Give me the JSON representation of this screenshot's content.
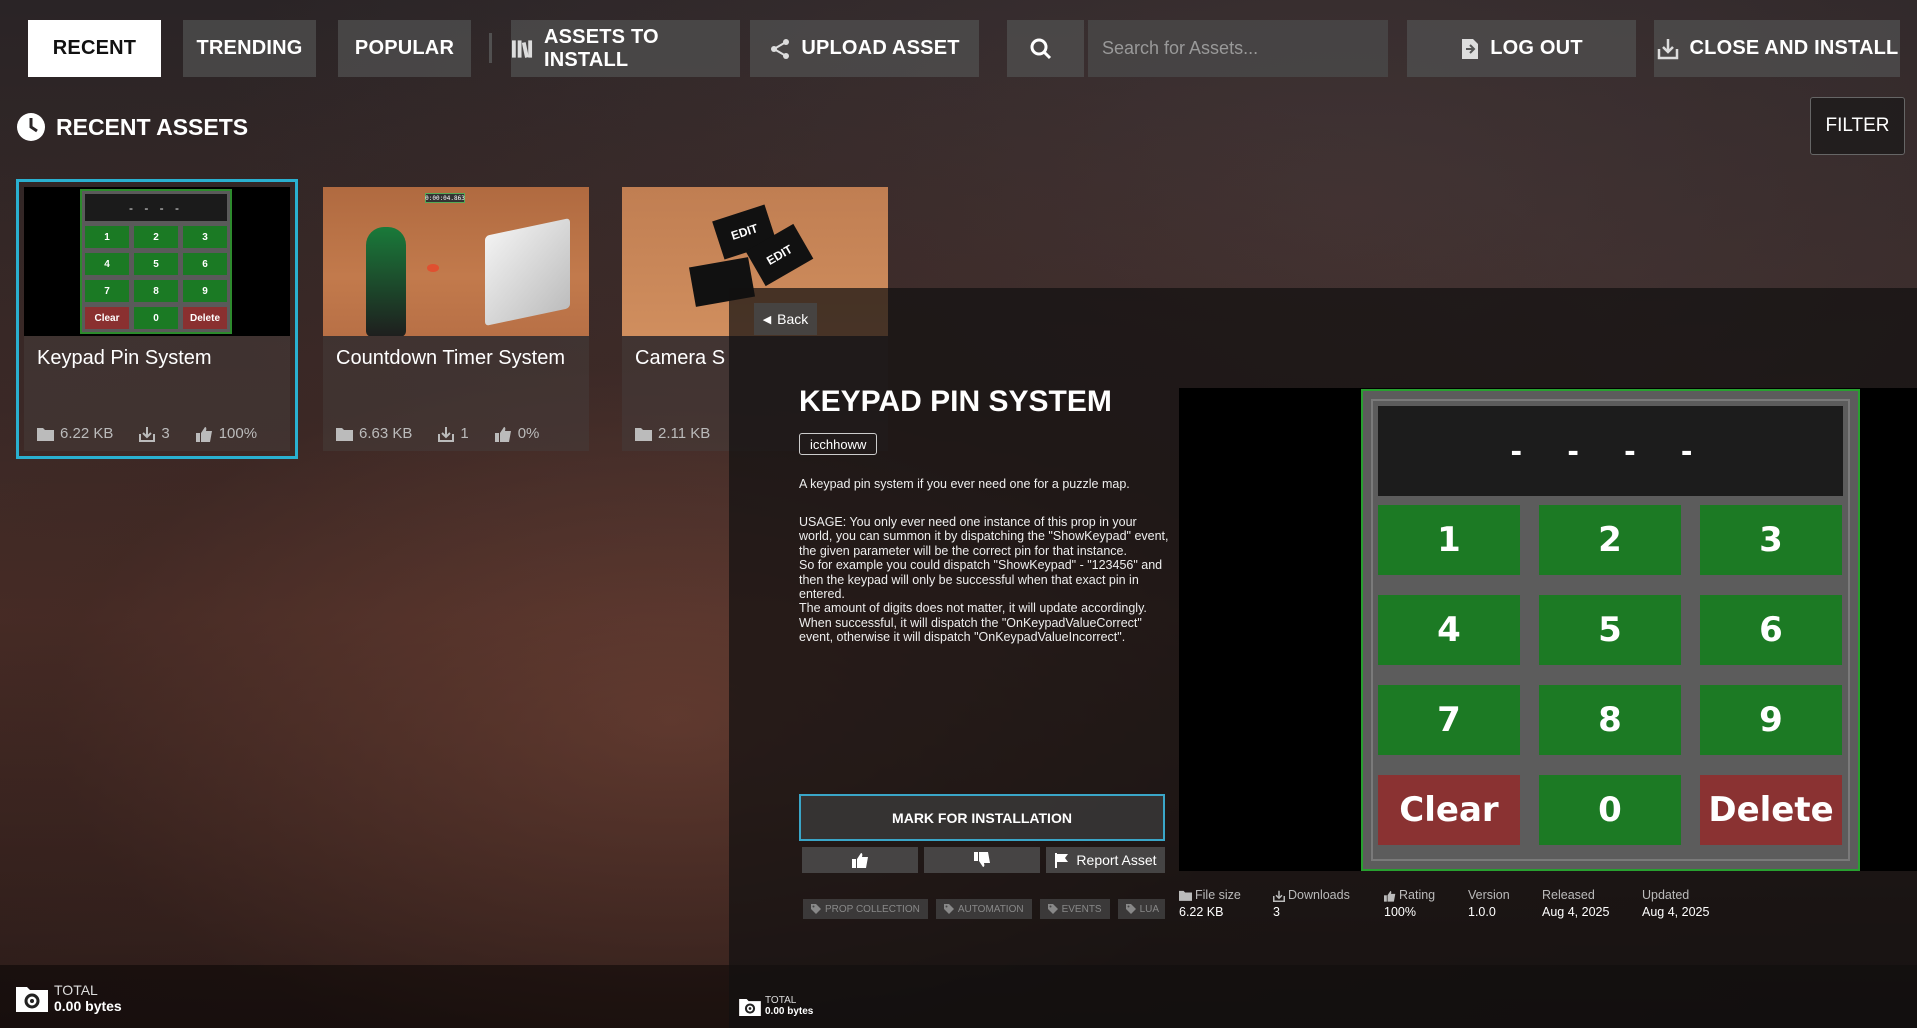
{
  "nav": {
    "recent": "RECENT",
    "trending": "TRENDING",
    "popular": "POPULAR",
    "assets_to_install": "ASSETS TO INSTALL",
    "upload_asset": "UPLOAD ASSET",
    "search_placeholder": "Search for Assets...",
    "log_out": "LOG OUT",
    "close_and_install": "CLOSE AND INSTALL"
  },
  "section": {
    "title": "RECENT ASSETS",
    "filter": "FILTER"
  },
  "cards": [
    {
      "title": "Keypad Pin System",
      "size": "6.22 KB",
      "downloads": "3",
      "rating": "100%"
    },
    {
      "title": "Countdown Timer System",
      "size": "6.63 KB",
      "downloads": "1",
      "rating": "0%"
    },
    {
      "title": "Camera S",
      "size": "2.11 KB"
    }
  ],
  "mini_keypad": {
    "display": "- - - -",
    "keys": [
      "1",
      "2",
      "3",
      "4",
      "5",
      "6",
      "7",
      "8",
      "9",
      "Clear",
      "0",
      "Delete"
    ]
  },
  "countdown_thumb_text": "0:00:04.863",
  "camera_thumb_text": "EDIT",
  "detail": {
    "back": "Back",
    "title": "KEYPAD PIN SYSTEM",
    "author": "icchhoww",
    "description": "A keypad pin system if you ever need one for a puzzle map.",
    "usage": "USAGE: You only ever need one instance of this prop in your world, you can summon it by dispatching the \"ShowKeypad\" event, the given parameter will be the correct pin for that instance.\nSo for example you could dispatch \"ShowKeypad\" - \"123456\" and then the keypad will only be successful when that exact pin in entered.\nThe amount of digits does not matter, it will update accordingly.\nWhen successful, it will dispatch the \"OnKeypadValueCorrect\" event, otherwise it will dispatch \"OnKeypadValueIncorrect\".",
    "mark_button": "MARK FOR INSTALLATION",
    "report": "Report Asset",
    "tags": [
      "PROP COLLECTION",
      "AUTOMATION",
      "EVENTS",
      "LUA"
    ],
    "preview_display": "- - - -",
    "preview_keys": [
      "1",
      "2",
      "3",
      "4",
      "5",
      "6",
      "7",
      "8",
      "9",
      "Clear",
      "0",
      "Delete"
    ],
    "meta": [
      {
        "label": "File size",
        "value": "6.22 KB",
        "icon": "folder-icon"
      },
      {
        "label": "Downloads",
        "value": "3",
        "icon": "download-icon"
      },
      {
        "label": "Rating",
        "value": "100%",
        "icon": "thumbs-up-icon"
      },
      {
        "label": "Version",
        "value": "1.0.0"
      },
      {
        "label": "Released",
        "value": "Aug 4, 2025"
      },
      {
        "label": "Updated",
        "value": "Aug 4, 2025"
      }
    ]
  },
  "footer": {
    "total_label": "TOTAL",
    "total_value": "0.00 bytes"
  },
  "colors": {
    "accent_selected": "#2ab0d0",
    "key_green": "#1c7a24",
    "key_red": "#8a3232"
  }
}
